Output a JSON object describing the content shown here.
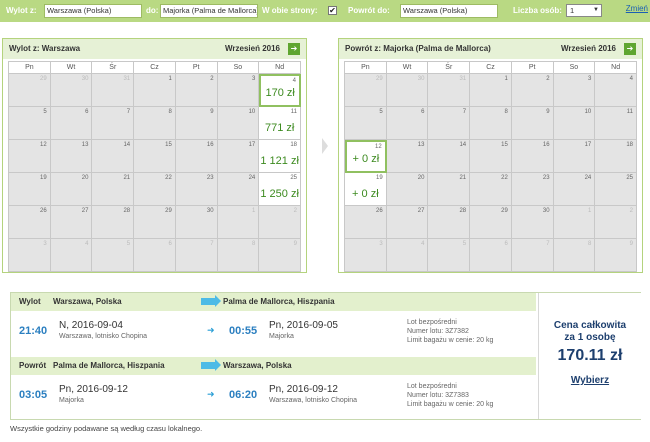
{
  "search": {
    "from_label": "Wylot z:",
    "from_value": "Warszawa (Polska)",
    "to_label": "do:",
    "to_value": "Majorka (Palma de Mallorca)",
    "both_ways_label": "W obie strony:",
    "both_ways_checked": "✔",
    "return_from_label": "Powrót do:",
    "return_from_value": "Warszawa (Polska)",
    "persons_label": "Liczba osób:",
    "persons_value": "1",
    "change_link": "Zmień"
  },
  "cal_out": {
    "title": "Wylot z: Warszawa",
    "month": "Wrzesień 2016",
    "nav": "➔",
    "weekdays": [
      "Pn",
      "Wt",
      "Śr",
      "Cz",
      "Pt",
      "So",
      "Nd"
    ],
    "days": [
      {
        "n": "29",
        "o": true
      },
      {
        "n": "30",
        "o": true
      },
      {
        "n": "31",
        "o": true
      },
      {
        "n": "1"
      },
      {
        "n": "2"
      },
      {
        "n": "3"
      },
      {
        "n": "4",
        "p": "170 zł",
        "sel": true
      },
      {
        "n": "5"
      },
      {
        "n": "6"
      },
      {
        "n": "7"
      },
      {
        "n": "8"
      },
      {
        "n": "9"
      },
      {
        "n": "10"
      },
      {
        "n": "11",
        "p": "771 zł"
      },
      {
        "n": "12"
      },
      {
        "n": "13"
      },
      {
        "n": "14"
      },
      {
        "n": "15"
      },
      {
        "n": "16"
      },
      {
        "n": "17"
      },
      {
        "n": "18",
        "p": "1 121 zł"
      },
      {
        "n": "19"
      },
      {
        "n": "20"
      },
      {
        "n": "21"
      },
      {
        "n": "22"
      },
      {
        "n": "23"
      },
      {
        "n": "24"
      },
      {
        "n": "25",
        "p": "1 250 zł"
      },
      {
        "n": "26"
      },
      {
        "n": "27"
      },
      {
        "n": "28"
      },
      {
        "n": "29"
      },
      {
        "n": "30"
      },
      {
        "n": "1",
        "o": true
      },
      {
        "n": "2",
        "o": true
      },
      {
        "n": "3",
        "o": true
      },
      {
        "n": "4",
        "o": true
      },
      {
        "n": "5",
        "o": true
      },
      {
        "n": "6",
        "o": true
      },
      {
        "n": "7",
        "o": true
      },
      {
        "n": "8",
        "o": true
      },
      {
        "n": "9",
        "o": true
      }
    ]
  },
  "cal_ret": {
    "title": "Powrót z: Majorka (Palma de Mallorca)",
    "month": "Wrzesień 2016",
    "nav": "➔",
    "weekdays": [
      "Pn",
      "Wt",
      "Śr",
      "Cz",
      "Pt",
      "So",
      "Nd"
    ],
    "days": [
      {
        "n": "29",
        "o": true
      },
      {
        "n": "30",
        "o": true
      },
      {
        "n": "31",
        "o": true
      },
      {
        "n": "1"
      },
      {
        "n": "2"
      },
      {
        "n": "3"
      },
      {
        "n": "4"
      },
      {
        "n": "5"
      },
      {
        "n": "6"
      },
      {
        "n": "7"
      },
      {
        "n": "8"
      },
      {
        "n": "9"
      },
      {
        "n": "10"
      },
      {
        "n": "11"
      },
      {
        "n": "12",
        "p": "+ 0 zł",
        "sel": true
      },
      {
        "n": "13"
      },
      {
        "n": "14"
      },
      {
        "n": "15"
      },
      {
        "n": "16"
      },
      {
        "n": "17"
      },
      {
        "n": "18"
      },
      {
        "n": "19",
        "p": "+ 0 zł"
      },
      {
        "n": "20"
      },
      {
        "n": "21"
      },
      {
        "n": "22"
      },
      {
        "n": "23"
      },
      {
        "n": "24"
      },
      {
        "n": "25"
      },
      {
        "n": "26"
      },
      {
        "n": "27"
      },
      {
        "n": "28"
      },
      {
        "n": "29"
      },
      {
        "n": "30"
      },
      {
        "n": "1",
        "o": true
      },
      {
        "n": "2",
        "o": true
      },
      {
        "n": "3",
        "o": true
      },
      {
        "n": "4",
        "o": true
      },
      {
        "n": "5",
        "o": true
      },
      {
        "n": "6",
        "o": true
      },
      {
        "n": "7",
        "o": true
      },
      {
        "n": "8",
        "o": true
      },
      {
        "n": "9",
        "o": true
      }
    ]
  },
  "outbound": {
    "label": "Wylot",
    "from": "Warszawa, Polska",
    "to": "Palma de Mallorca, Hiszpania",
    "dep_time": "21:40",
    "dep_date": "N, 2016-09-04",
    "dep_place": "Warszawa, lotnisko Chopina",
    "arr_time": "00:55",
    "arr_date": "Pn, 2016-09-05",
    "arr_place": "Majorka",
    "info1": "Lot bezpośredni",
    "info2": "Numer lotu: 3Z7382",
    "info3": "Limit bagażu w cenie: 20 kg"
  },
  "inbound": {
    "label": "Powrót",
    "from": "Palma de Mallorca, Hiszpania",
    "to": "Warszawa, Polska",
    "dep_time": "03:05",
    "dep_date": "Pn, 2016-09-12",
    "dep_place": "Majorka",
    "arr_time": "06:20",
    "arr_date": "Pn, 2016-09-12",
    "arr_place": "Warszawa, lotnisko Chopina",
    "info1": "Lot bezpośredni",
    "info2": "Numer lotu: 3Z7383",
    "info3": "Limit bagażu w cenie: 20 kg"
  },
  "price": {
    "label_line1": "Cena całkowita",
    "label_line2": "za 1 osobę",
    "amount": "170.11 zł",
    "select": "Wybierz"
  },
  "footnote": "Wszystkie godziny podawane są według czasu lokalnego.",
  "colors": {
    "accent_green": "#b9d983",
    "price_green": "#3c8a1f",
    "time_blue": "#2b7fc0",
    "navy": "#1d3f6e"
  }
}
